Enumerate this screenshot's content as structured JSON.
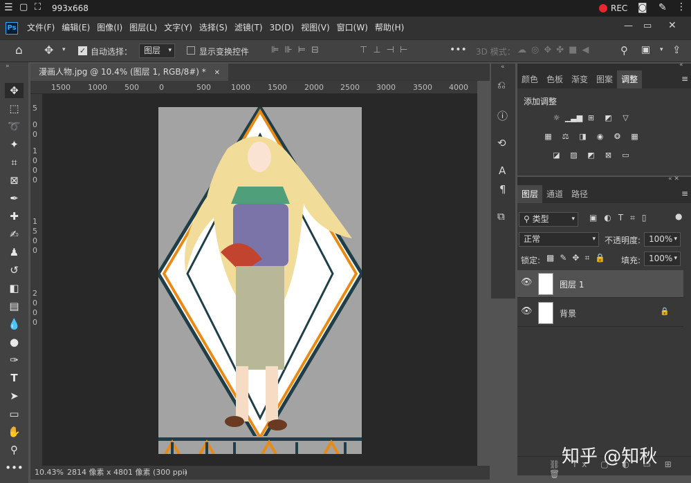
{
  "topbar": {
    "dims": "993x668",
    "rec": "REC"
  },
  "menu": [
    "文件(F)",
    "编辑(E)",
    "图像(I)",
    "图层(L)",
    "文字(Y)",
    "选择(S)",
    "滤镜(T)",
    "3D(D)",
    "视图(V)",
    "窗口(W)",
    "帮助(H)"
  ],
  "ps_logo": "Ps",
  "options": {
    "auto_select": "自动选择：",
    "layer_dropdown": "图层",
    "show_transform": "显示变换控件",
    "mode_3d": "3D 模式："
  },
  "document": {
    "tab_title": "漫画人物.jpg @ 10.4% (图层 1, RGB/8#) *",
    "zoom": "10.43%",
    "info": "2814 像素 x 4801 像素 (300 ppi)"
  },
  "ruler_top": [
    "1500",
    "1000",
    "500",
    "0",
    "500",
    "1000",
    "1500",
    "2000",
    "2500",
    "3000",
    "3500",
    "4000"
  ],
  "ruler_left": [
    "5",
    "0",
    "0",
    "1",
    "0",
    "0",
    "0",
    "1",
    "5",
    "0",
    "0",
    "2",
    "0",
    "0",
    "0"
  ],
  "adj_panel": {
    "tabs": [
      "颜色",
      "色板",
      "渐变",
      "图案",
      "调整"
    ],
    "active": "调整",
    "title": "添加调整"
  },
  "layers_panel": {
    "tabs": [
      "图层",
      "通道",
      "路径"
    ],
    "active": "图层",
    "filter": "类型",
    "blend": "正常",
    "opacity_label": "不透明度:",
    "opacity": "100%",
    "lock_label": "锁定:",
    "fill_label": "填充:",
    "fill": "100%",
    "layers": [
      {
        "name": "图层 1",
        "selected": true
      },
      {
        "name": "背景",
        "locked": true
      }
    ]
  },
  "watermark": "知乎 @知秋"
}
